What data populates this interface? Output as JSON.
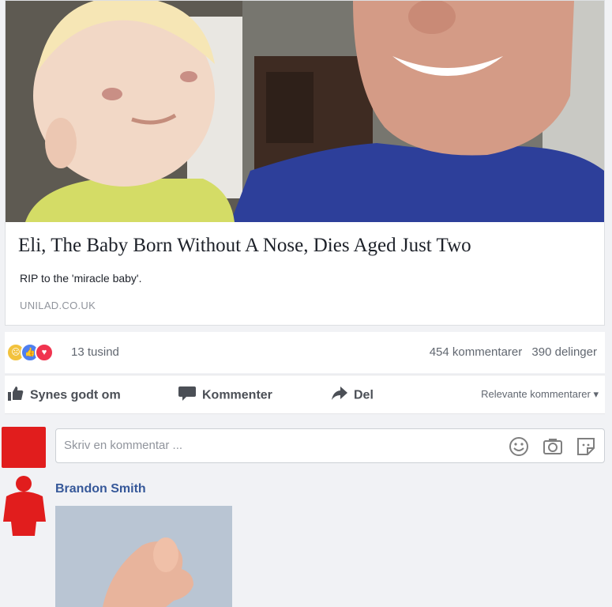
{
  "link_preview": {
    "title": "Eli, The Baby Born Without A Nose, Dies Aged Just Two",
    "description": "RIP to the 'miracle baby'.",
    "domain": "UNILAD.CO.UK"
  },
  "reactions": {
    "icons": [
      "sad-reaction",
      "like-reaction",
      "love-reaction"
    ],
    "total": "13 tusind",
    "comments": "454 kommentarer",
    "shares": "390 delinger"
  },
  "actions": {
    "like": "Synes godt om",
    "comment": "Kommenter",
    "share": "Del",
    "sort": "Relevante kommentarer"
  },
  "composer": {
    "placeholder": "Skriv en kommentar ...",
    "icons": [
      "emoji-icon",
      "camera-icon",
      "sticker-icon"
    ]
  },
  "comments": [
    {
      "author": "Brandon Smith"
    }
  ],
  "colors": {
    "accent": "#4267b2",
    "name_link": "#365899",
    "love": "#f0344f",
    "sad": "#f2c23d"
  }
}
